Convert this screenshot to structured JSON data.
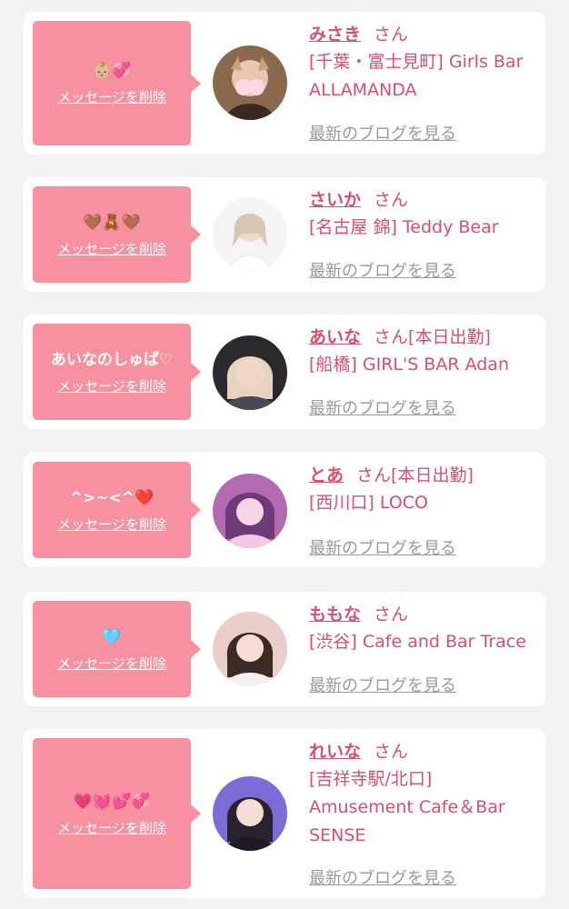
{
  "colors": {
    "bubble": "#f7909f",
    "accent": "#d94f6e",
    "muted": "#999999",
    "background": "#f2f2f2"
  },
  "entries": [
    {
      "message": "👶🏼💞",
      "delete_label": "メッセージを削除",
      "name": "みさき",
      "honorific": "さん",
      "status": "",
      "shop": "[千葉・富士見町] Girls Bar ALLAMANDA",
      "blog_label": "最新のブログを見る",
      "avatar_icon": "avatar-photo"
    },
    {
      "message": "🤎🧸🤎",
      "delete_label": "メッセージを削除",
      "name": "さいか",
      "honorific": "さん",
      "status": "",
      "shop": "[名古屋 錦] Teddy Bear",
      "blog_label": "最新のブログを見る",
      "avatar_icon": "avatar-photo"
    },
    {
      "message": "あいなのしゅぱ♡",
      "delete_label": "メッセージを削除",
      "name": "あいな",
      "honorific": "さん",
      "status": "[本日出勤]",
      "shop": "[船橋] GIRL'S BAR Adan",
      "blog_label": "最新のブログを見る",
      "avatar_icon": "avatar-photo"
    },
    {
      "message": "^>~<^❤️",
      "delete_label": "メッセージを削除",
      "name": "とあ",
      "honorific": "さん",
      "status": "[本日出勤]",
      "shop": "[西川口] LOCO",
      "blog_label": "最新のブログを見る",
      "avatar_icon": "avatar-photo"
    },
    {
      "message": "🩵",
      "delete_label": "メッセージを削除",
      "name": "ももな",
      "honorific": "さん",
      "status": "",
      "shop": "[渋谷] Cafe and Bar Trace",
      "blog_label": "最新のブログを見る",
      "avatar_icon": "avatar-photo"
    },
    {
      "message": "💗💓💕💞",
      "delete_label": "メッセージを削除",
      "name": "れいな",
      "honorific": "さん",
      "status": "",
      "shop": "[吉祥寺駅/北口] Amusement Cafe＆Bar SENSE",
      "blog_label": "最新のブログを見る",
      "avatar_icon": "avatar-photo"
    }
  ]
}
